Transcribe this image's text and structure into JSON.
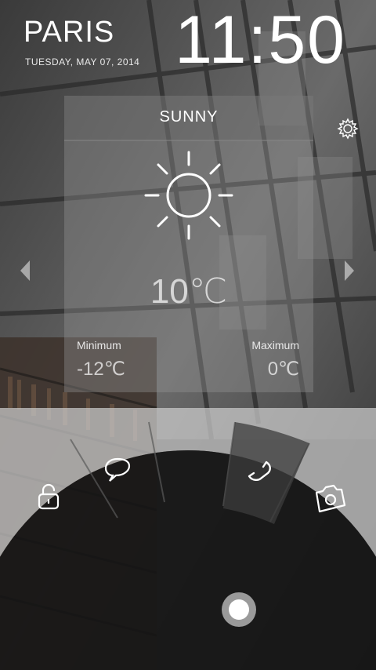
{
  "header": {
    "city": "PARIS",
    "date": "TUESDAY, MAY 07, 2014",
    "time": "11:50"
  },
  "weather": {
    "condition": "SUNNY",
    "temperature": "10℃",
    "min_label": "Minimum",
    "min_value": "-12℃",
    "max_label": "Maximum",
    "max_value": "0℃",
    "icon": "sun-icon"
  },
  "controls": {
    "settings_icon": "gear-icon",
    "prev_icon": "chevron-left-icon",
    "next_icon": "chevron-right-icon"
  },
  "shortcuts": {
    "items": [
      "lock-icon",
      "message-icon",
      "phone-icon",
      "camera-icon"
    ],
    "active": "phone-icon",
    "center_handle": "unlock-handle"
  }
}
